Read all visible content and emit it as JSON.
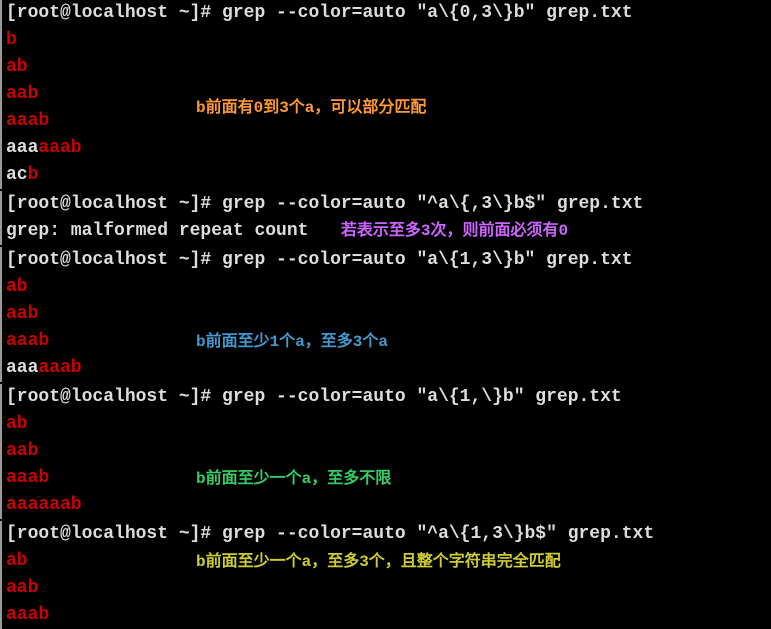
{
  "blocks": [
    {
      "prompt": "[root@localhost ~]# ",
      "command": "grep --color=auto \"a\\{0,3\\}b\" grep.txt",
      "output": [
        {
          "segments": [
            {
              "t": "b",
              "c": "red"
            }
          ]
        },
        {
          "segments": [
            {
              "t": "ab",
              "c": "red"
            }
          ]
        },
        {
          "segments": [
            {
              "t": "aab",
              "c": "red"
            }
          ]
        },
        {
          "segments": [
            {
              "t": "aaab",
              "c": "red"
            }
          ],
          "note": {
            "text": "b前面有0到3个a，可以部分匹配",
            "cls": "note-orange",
            "pos": "190"
          }
        },
        {
          "segments": [
            {
              "t": "aaa",
              "c": "plain"
            },
            {
              "t": "aaab",
              "c": "red"
            }
          ]
        },
        {
          "segments": [
            {
              "t": "ac",
              "c": "plain"
            },
            {
              "t": "b",
              "c": "red"
            }
          ]
        }
      ]
    },
    {
      "prompt": "[root@localhost ~]# ",
      "command": "grep --color=auto \"^a\\{,3\\}b$\" grep.txt",
      "output": [
        {
          "segments": [
            {
              "t": "grep: malformed repeat count   ",
              "c": "plain"
            }
          ],
          "note": {
            "text": "若表示至多3次，则前面必须有0",
            "cls": "note-purple",
            "pos": "inline"
          }
        }
      ]
    },
    {
      "prompt": "[root@localhost ~]# ",
      "command": "grep --color=auto \"a\\{1,3\\}b\" grep.txt",
      "output": [
        {
          "segments": [
            {
              "t": "ab",
              "c": "red"
            }
          ]
        },
        {
          "segments": [
            {
              "t": "aab",
              "c": "red"
            }
          ]
        },
        {
          "segments": [
            {
              "t": "aaab",
              "c": "red"
            }
          ],
          "note": {
            "text": "b前面至少1个a，至多3个a",
            "cls": "note-blue",
            "pos": "190"
          }
        },
        {
          "segments": [
            {
              "t": "aaa",
              "c": "plain"
            },
            {
              "t": "aaab",
              "c": "red"
            }
          ]
        }
      ]
    },
    {
      "prompt": "[root@localhost ~]# ",
      "command": "grep --color=auto \"a\\{1,\\}b\" grep.txt",
      "output": [
        {
          "segments": [
            {
              "t": "ab",
              "c": "red"
            }
          ]
        },
        {
          "segments": [
            {
              "t": "aab",
              "c": "red"
            }
          ]
        },
        {
          "segments": [
            {
              "t": "aaab",
              "c": "red"
            }
          ],
          "note": {
            "text": "b前面至少一个a，至多不限",
            "cls": "note-green",
            "pos": "190"
          }
        },
        {
          "segments": [
            {
              "t": "aaaaaab",
              "c": "red"
            }
          ]
        }
      ]
    },
    {
      "prompt": "[root@localhost ~]# ",
      "command": "grep --color=auto \"^a\\{1,3\\}b$\" grep.txt",
      "output": [
        {
          "segments": [
            {
              "t": "ab",
              "c": "red"
            }
          ],
          "note": {
            "text": "b前面至少一个a，至多3个，且整个字符串完全匹配",
            "cls": "note-yellow",
            "pos": "190"
          }
        },
        {
          "segments": [
            {
              "t": "aab",
              "c": "red"
            }
          ]
        },
        {
          "segments": [
            {
              "t": "aaab",
              "c": "red"
            }
          ]
        }
      ]
    }
  ]
}
